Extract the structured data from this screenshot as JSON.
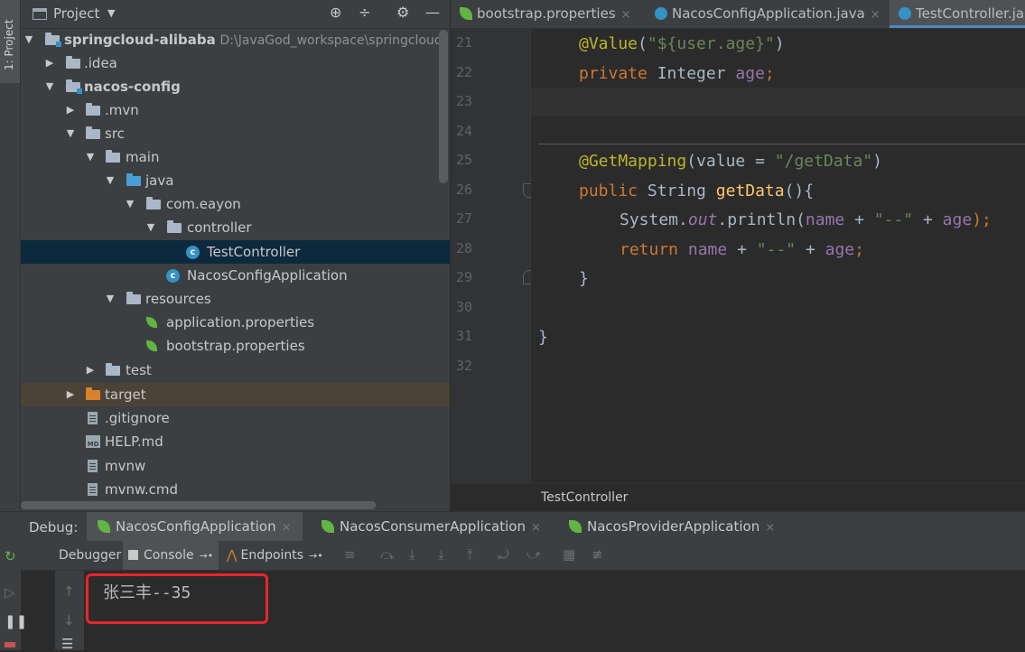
{
  "project_panel": {
    "stripe_label": "1: Project",
    "title": "Project",
    "root": {
      "name": "springcloud-alibaba",
      "path": "D:\\JavaGod_workspace\\springcloud-"
    },
    "tree": [
      {
        "label": ".idea"
      },
      {
        "label": "nacos-config"
      },
      {
        "label": ".mvn"
      },
      {
        "label": "src"
      },
      {
        "label": "main"
      },
      {
        "label": "java"
      },
      {
        "label": "com.eayon"
      },
      {
        "label": "controller"
      },
      {
        "label": "TestController"
      },
      {
        "label": "NacosConfigApplication"
      },
      {
        "label": "resources"
      },
      {
        "label": "application.properties"
      },
      {
        "label": "bootstrap.properties"
      },
      {
        "label": "test"
      },
      {
        "label": "target"
      },
      {
        "label": ".gitignore"
      },
      {
        "label": "HELP.md"
      },
      {
        "label": "mvnw"
      },
      {
        "label": "mvnw.cmd"
      }
    ]
  },
  "editor": {
    "tabs": [
      {
        "label": "bootstrap.properties"
      },
      {
        "label": "NacosConfigApplication.java"
      },
      {
        "label": "TestController.ja"
      }
    ],
    "line_numbers": [
      "21",
      "22",
      "23",
      "24",
      "25",
      "26",
      "27",
      "28",
      "29",
      "30",
      "31",
      "32"
    ],
    "code": {
      "l21_ann": "@Value",
      "l21_p1": "(",
      "l21_str": "\"${user.age}\"",
      "l21_p2": ")",
      "l22_kw": "private",
      "l22_type": " Integer ",
      "l22_fld": "age",
      "l22_semi": ";",
      "l25_ann": "@GetMapping",
      "l25_p1": "(value = ",
      "l25_str": "\"/getData\"",
      "l25_p2": ")",
      "l26_kw": "public",
      "l26_type": " String ",
      "l26_m": "getData",
      "l26_p": "(){",
      "l27_a": "System.",
      "l27_out": "out",
      "l27_b": ".println(",
      "l27_name": "name",
      "l27_c": " + ",
      "l27_str": "\"--\"",
      "l27_d": " + ",
      "l27_age": "age",
      "l27_e": ");",
      "l28_kw": "return",
      "l28_a": " ",
      "l28_name": "name",
      "l28_b": " + ",
      "l28_str": "\"--\"",
      "l28_c": " + ",
      "l28_age": "age",
      "l28_semi": ";",
      "l29": "}",
      "l31": "}"
    },
    "breadcrumb": "TestController"
  },
  "debug": {
    "label": "Debug:",
    "tabs": [
      {
        "label": "NacosConfigApplication"
      },
      {
        "label": "NacosConsumerApplication"
      },
      {
        "label": "NacosProviderApplication"
      }
    ],
    "toolbar": {
      "debugger": "Debugger",
      "console": "Console",
      "endpoints": "Endpoints"
    },
    "console_output": "张三丰--35",
    "colors": {
      "highlight_box": "#e8262b",
      "accent": "#4a88c7"
    }
  }
}
